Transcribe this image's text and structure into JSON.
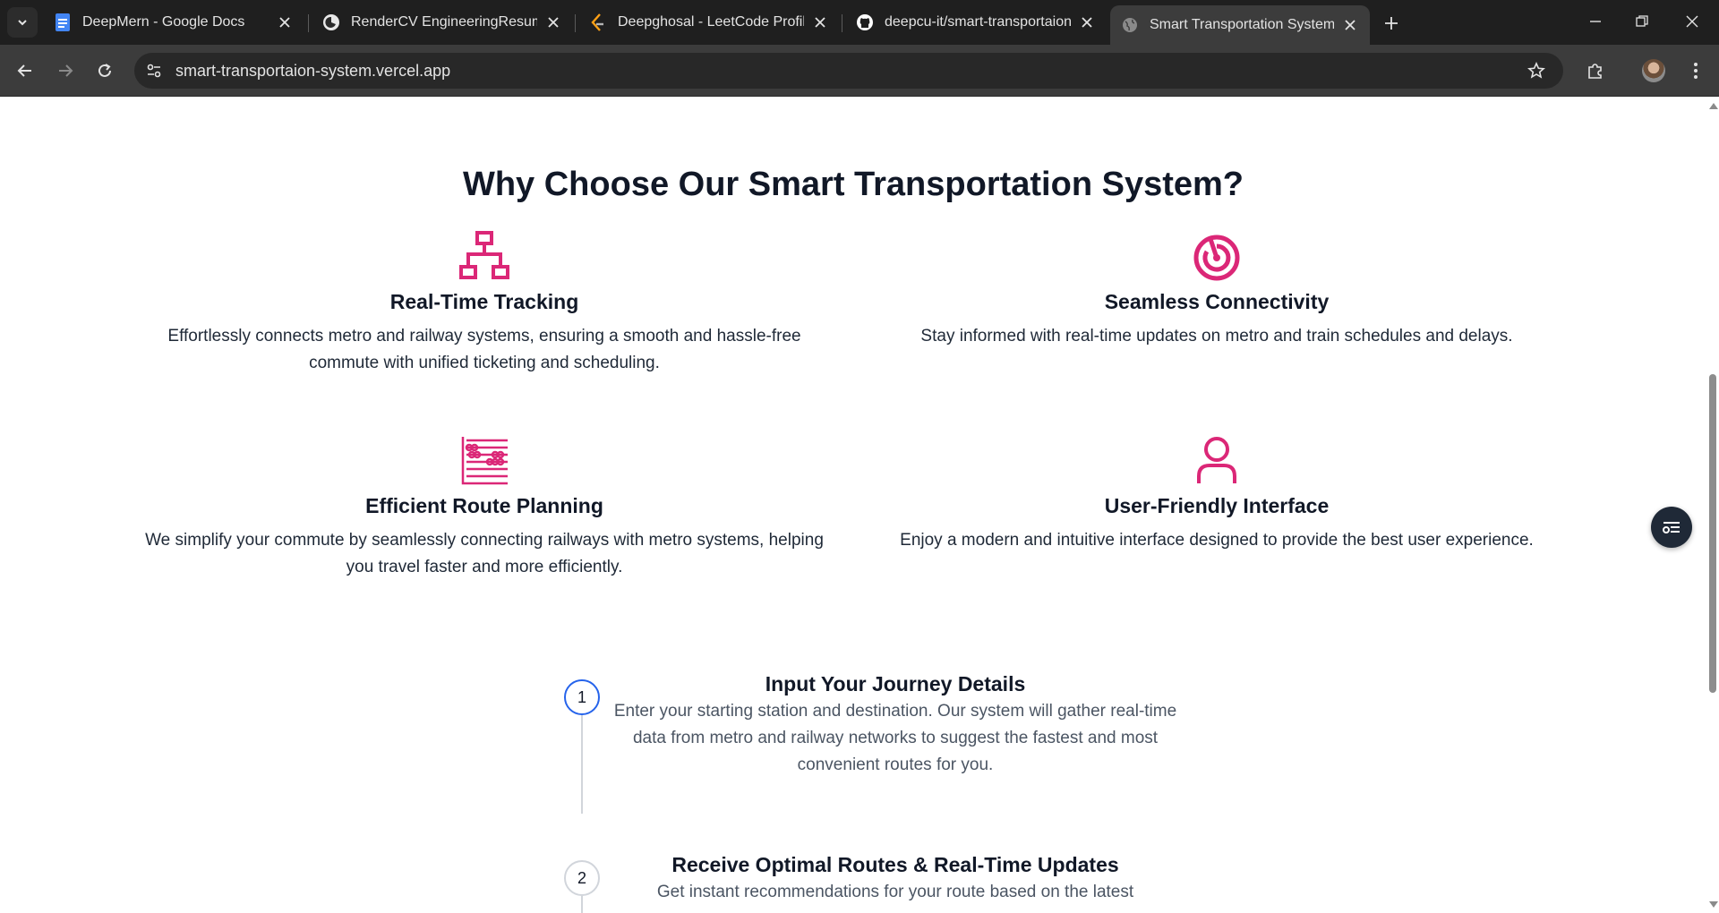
{
  "browser": {
    "tabs": [
      {
        "title": "DeepMern - Google Docs",
        "icon": "google-docs-icon"
      },
      {
        "title": "RenderCV EngineeringResumes",
        "icon": "rendercv-icon"
      },
      {
        "title": "Deepghosal - LeetCode Profile",
        "icon": "leetcode-icon"
      },
      {
        "title": "deepcu-it/smart-transportaion-",
        "icon": "github-icon"
      },
      {
        "title": "Smart Transportation System",
        "icon": "globe-icon"
      }
    ],
    "active_tab": 4,
    "url": "smart-transportaion-system.vercel.app"
  },
  "page": {
    "section_title": "Why Choose Our Smart Transportation System?",
    "features": [
      {
        "icon": "network-icon",
        "title": "Real-Time Tracking",
        "description": "Effortlessly connects metro and railway systems, ensuring a smooth and hassle-free commute with unified ticketing and scheduling."
      },
      {
        "icon": "radar-icon",
        "title": "Seamless Connectivity",
        "description": "Stay informed with real-time updates on metro and train schedules and delays."
      },
      {
        "icon": "abacus-icon",
        "title": "Efficient Route Planning",
        "description": "We simplify your commute by seamlessly connecting railways with metro systems, helping you travel faster and more efficiently."
      },
      {
        "icon": "user-icon",
        "title": "User-Friendly Interface",
        "description": "Enjoy a modern and intuitive interface designed to provide the best user experience."
      }
    ],
    "steps": [
      {
        "number": "1",
        "title": "Input Your Journey Details",
        "description": "Enter your starting station and destination. Our system will gather real-time data from metro and railway networks to suggest the fastest and most convenient routes for you."
      },
      {
        "number": "2",
        "title": "Receive Optimal Routes & Real-Time Updates",
        "description": "Get instant recommendations for your route based on the latest"
      }
    ]
  },
  "colors": {
    "accent_pink": "#db2777",
    "step_active": "#2563eb",
    "chrome_dark": "#1f1f1f"
  }
}
